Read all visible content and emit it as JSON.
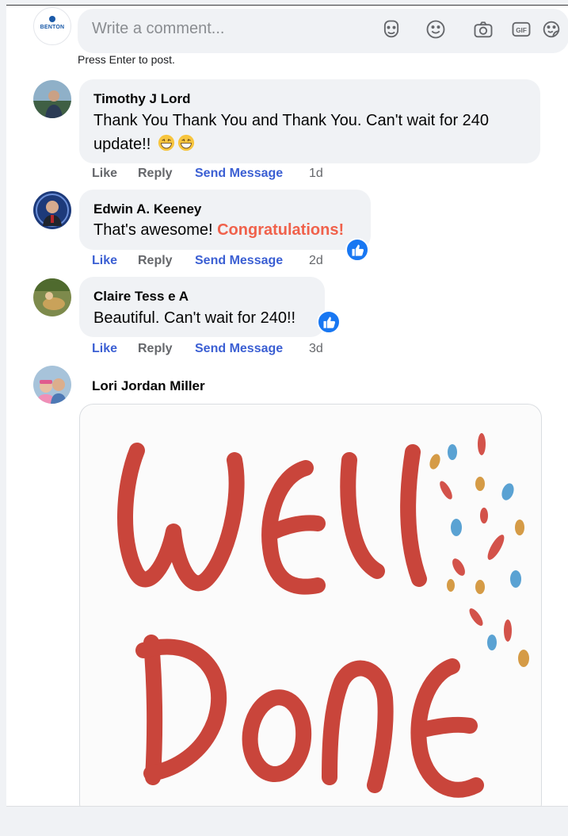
{
  "composer": {
    "avatar_text": "BENTON",
    "placeholder": "Write a comment...",
    "hint": "Press Enter to post.",
    "icons": [
      "sticker-face-icon",
      "emoji-icon",
      "camera-icon",
      "gif-icon",
      "sticker-icon"
    ]
  },
  "actions": {
    "like": "Like",
    "reply": "Reply",
    "send": "Send Message"
  },
  "comments": [
    {
      "author": "Timothy J Lord",
      "text_line1": "Thank You Thank You and Thank You. Can't wait for 240",
      "text_line2": "update!!",
      "time": "1d",
      "emoji": "grinning-face-icon"
    },
    {
      "author": "Edwin A. Keeney",
      "text_before": "That's awesome! ",
      "text_highlight": "Congratulations",
      "text_after": "!",
      "time": "2d",
      "reaction": "like-icon"
    },
    {
      "author": "Claire Tess e A",
      "text": "Beautiful. Can't wait for 240!!",
      "time": "3d",
      "reaction": "like-icon"
    },
    {
      "author": "Lori Jordan Miller",
      "gif_line1": "WEll",
      "gif_line2": "DoNE"
    }
  ],
  "colors": {
    "send_message": "#3b5fd3",
    "highlight": "#f0614b",
    "like_badge": "#1877f2",
    "gif_ink": "#c9453b"
  }
}
